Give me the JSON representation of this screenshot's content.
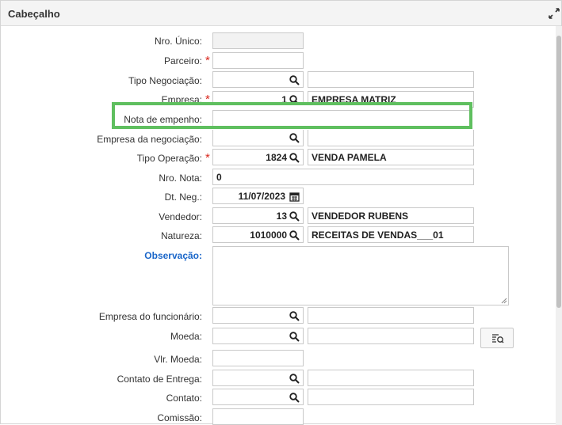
{
  "header": {
    "title": "Cabeçalho"
  },
  "labels": {
    "nro_unico": "Nro. Único:",
    "parceiro": "Parceiro:",
    "tipo_negociacao": "Tipo Negociação:",
    "empresa": "Empresa:",
    "nota_empenho": "Nota de empenho:",
    "empresa_negociacao": "Empresa da negociação:",
    "tipo_operacao": "Tipo Operação:",
    "nro_nota": "Nro. Nota:",
    "dt_neg": "Dt. Neg.:",
    "vendedor": "Vendedor:",
    "natureza": "Natureza:",
    "observacao": "Observação:",
    "empresa_funcionario": "Empresa do funcionário:",
    "moeda": "Moeda:",
    "vlr_moeda": "Vlr. Moeda:",
    "contato_entrega": "Contato de Entrega:",
    "contato": "Contato:",
    "comissao": "Comissão:"
  },
  "required_mark": "*",
  "values": {
    "empresa_code": "1",
    "empresa_name": "EMPRESA MATRIZ",
    "tipo_operacao_code": "1824",
    "tipo_operacao_name": "VENDA PAMELA",
    "nro_nota": "0",
    "dt_neg": "11/07/2023",
    "vendedor_code": "13",
    "vendedor_name": "VENDEDOR RUBENS",
    "natureza_code": "1010000",
    "natureza_name": "RECEITAS DE VENDAS___01"
  },
  "colors": {
    "highlight": "#5fbf5f",
    "required": "#d9261c",
    "link": "#1a66c9"
  }
}
